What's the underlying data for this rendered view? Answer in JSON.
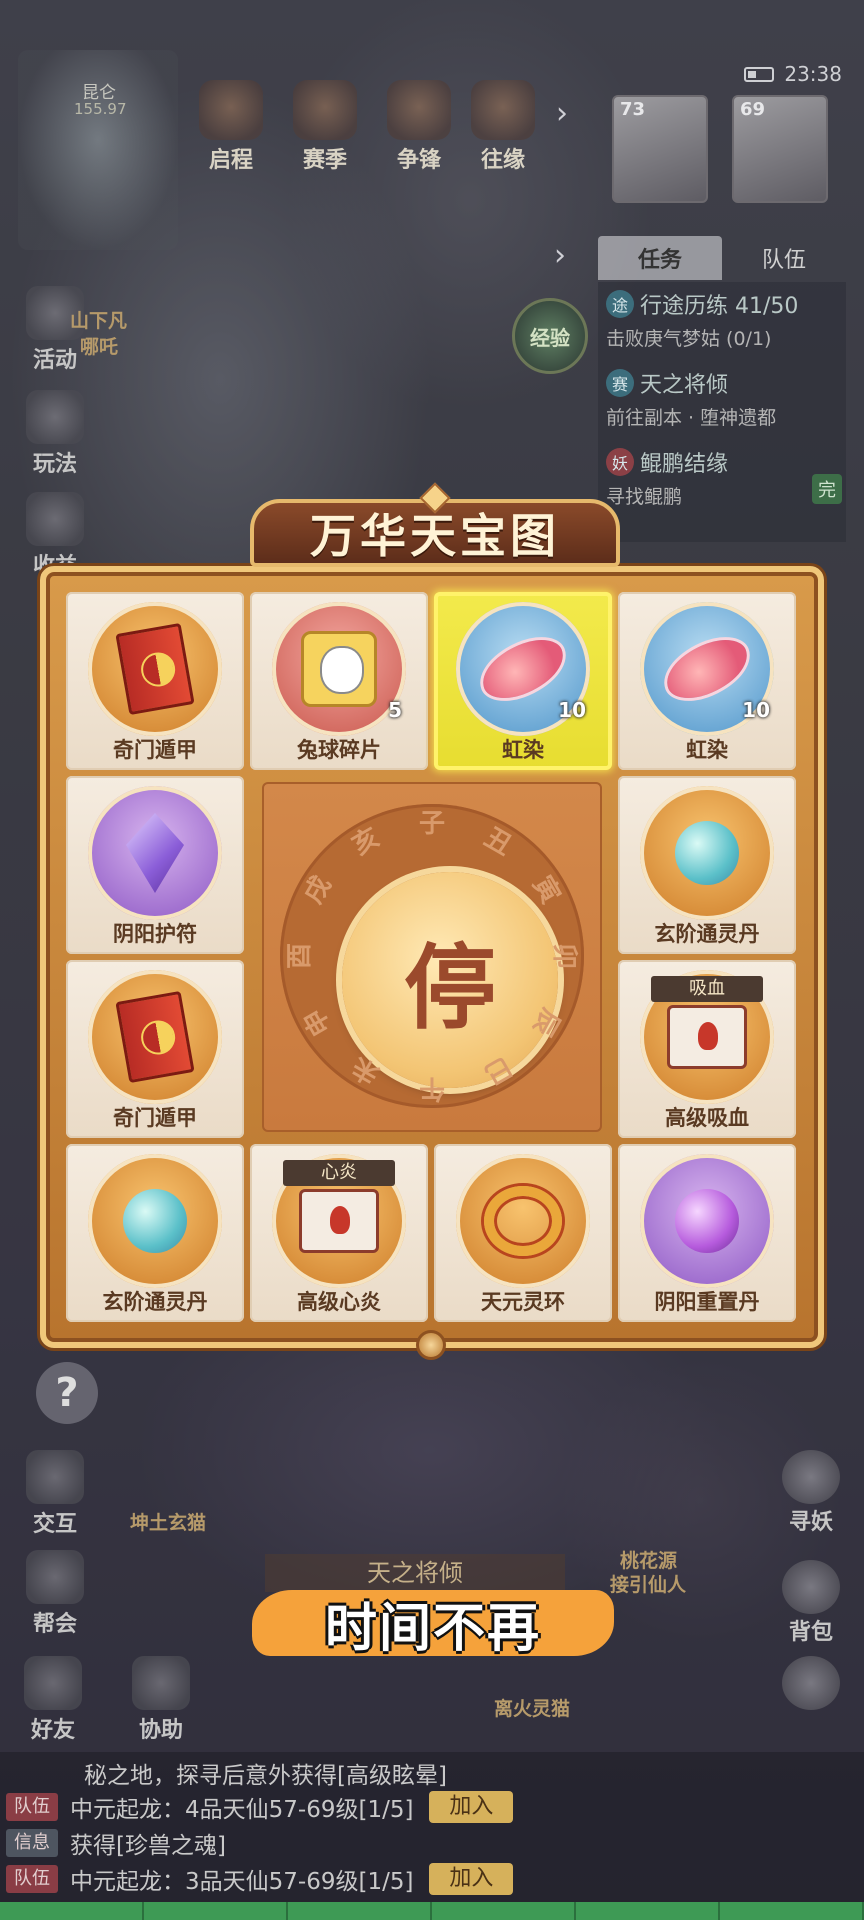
{
  "hud": {
    "map_name": "昆仑",
    "map_coord": "155.97",
    "top_icons": [
      "启程",
      "赛季",
      "争锋",
      "往缘"
    ],
    "time": "23:38",
    "portraits": [
      {
        "level": "73"
      },
      {
        "level": "69"
      }
    ],
    "exp_label": "经验"
  },
  "task_panel": {
    "tabs": [
      "任务",
      "队伍"
    ],
    "tasks": [
      {
        "badge": "途",
        "title": "行途历练 41/50",
        "desc": "击败庚气梦姑 (0/1)"
      },
      {
        "badge": "赛",
        "title": "天之将倾",
        "desc": "前往副本 · 堕神遗都"
      },
      {
        "badge": "妖",
        "title": "鲲鹏结缘",
        "desc": "寻找鲲鹏"
      }
    ],
    "done_label": "完"
  },
  "left_menu": [
    "活动",
    "玩法",
    "收益"
  ],
  "map_labels": {
    "npc_top": "山下凡",
    "npc_top2": "哪吒",
    "pet": "坤土玄猫",
    "npc_right": "桃花源",
    "npc_right2": "接引仙人",
    "pet2": "离火灵猫"
  },
  "board": {
    "title": "万华天宝图",
    "cells": [
      {
        "name": "奇门遁甲",
        "count": "",
        "tag": "",
        "highlighted": false,
        "icon": "book-icon"
      },
      {
        "name": "兔球碎片",
        "count": "5",
        "tag": "",
        "highlighted": false,
        "icon": "puzzle-icon"
      },
      {
        "name": "虹染",
        "count": "10",
        "tag": "",
        "highlighted": true,
        "icon": "drop-icon"
      },
      {
        "name": "虹染",
        "count": "10",
        "tag": "",
        "highlighted": false,
        "icon": "drop-icon"
      },
      {
        "name": "阴阳护符",
        "count": "",
        "tag": "",
        "highlighted": false,
        "icon": "amulet-icon"
      },
      {
        "name": "玄阶通灵丹",
        "count": "",
        "tag": "",
        "highlighted": false,
        "icon": "orb-icon"
      },
      {
        "name": "奇门遁甲",
        "count": "",
        "tag": "",
        "highlighted": false,
        "icon": "book-icon"
      },
      {
        "name": "高级吸血",
        "count": "",
        "tag": "吸血",
        "highlighted": false,
        "icon": "scroll-icon"
      },
      {
        "name": "玄阶通灵丹",
        "count": "",
        "tag": "",
        "highlighted": false,
        "icon": "orb-icon"
      },
      {
        "name": "高级心炎",
        "count": "",
        "tag": "心炎",
        "highlighted": false,
        "icon": "scroll-icon"
      },
      {
        "name": "天元灵环",
        "count": "",
        "tag": "",
        "highlighted": false,
        "icon": "ring-icon"
      },
      {
        "name": "阴阳重置丹",
        "count": "",
        "tag": "",
        "highlighted": false,
        "icon": "purple-orb-icon"
      }
    ],
    "zodiac": [
      "子",
      "丑",
      "寅",
      "卯",
      "辰",
      "巳",
      "午",
      "未",
      "申",
      "酉",
      "戌",
      "亥"
    ],
    "stop_label": "停"
  },
  "subtitle": "时间不再",
  "quest_banner": "天之将倾",
  "right_menu": [
    "寻妖",
    "背包"
  ],
  "bottom_left": [
    "交互",
    "帮会",
    "好友",
    "协助"
  ],
  "chat": {
    "lines": [
      {
        "channel": "",
        "text": "秘之地，探寻后意外获得[高级眩晕]",
        "join": ""
      },
      {
        "channel": "队伍",
        "text": "中元起龙：4品天仙57-69级[1/5]",
        "join": "加入"
      },
      {
        "channel": "信息",
        "text": "获得[珍兽之魂]",
        "join": ""
      },
      {
        "channel": "队伍",
        "text": "中元起龙：3品天仙57-69级[1/5]",
        "join": "加入"
      }
    ]
  },
  "colors": {
    "board_gold": "#f0c77a",
    "highlight": "#f3ea4c",
    "subtitle_bg": "#f5a23b"
  }
}
